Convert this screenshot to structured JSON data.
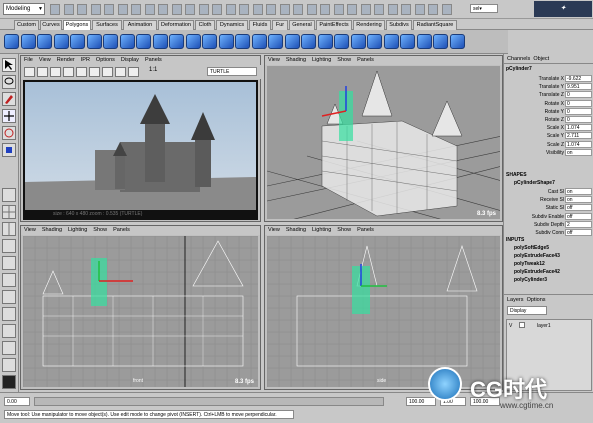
{
  "mode_menu": "Modeling",
  "shelf_tabs": [
    "Custom",
    "Curves",
    "Polygons",
    "Surfaces",
    "Animation",
    "Deformation",
    "Cloth",
    "Dynamics",
    "Fluids",
    "Fur",
    "General",
    "PaintEffects",
    "Rendering",
    "Subdivs",
    "RadiantSquare"
  ],
  "active_shelf_tab": "Polygons",
  "selection_field": "sel▾",
  "render_view": {
    "menu": [
      "File",
      "View",
      "Render",
      "IPR",
      "Options",
      "Display",
      "Panels"
    ],
    "ratio_label": "1:1",
    "renderer": "TURTLE",
    "footer": "size : 640 x 480  zoom : 0.535  (TURTLE)"
  },
  "persp": {
    "menu": [
      "View",
      "Shading",
      "Lighting",
      "Show",
      "Panels"
    ],
    "fps": "8.3 fps"
  },
  "front": {
    "menu": [
      "View",
      "Shading",
      "Lighting",
      "Show",
      "Panels"
    ],
    "fps": "8.3 fps",
    "label": "front"
  },
  "side": {
    "menu": [
      "View",
      "Shading",
      "Lighting",
      "Show",
      "Panels"
    ],
    "label": "side"
  },
  "channel_box": {
    "tabs": [
      "Channels",
      "Object"
    ],
    "node": "pCylinder7",
    "attrs": [
      {
        "k": "Translate X",
        "v": "-9.622"
      },
      {
        "k": "Translate Y",
        "v": "9.951"
      },
      {
        "k": "Translate Z",
        "v": "0"
      },
      {
        "k": "Rotate X",
        "v": "0"
      },
      {
        "k": "Rotate Y",
        "v": "0"
      },
      {
        "k": "Rotate Z",
        "v": "0"
      },
      {
        "k": "Scale X",
        "v": "1.074"
      },
      {
        "k": "Scale Y",
        "v": "2.711"
      },
      {
        "k": "Scale Z",
        "v": "1.074"
      },
      {
        "k": "Visibility",
        "v": "on"
      }
    ],
    "shapes_header": "SHAPES",
    "shape_node": "pCylinderShape7",
    "shape_attrs": [
      {
        "k": "Cast Sl",
        "v": "on"
      },
      {
        "k": "Receive Sl",
        "v": "on"
      },
      {
        "k": "Static Sl",
        "v": "off"
      },
      {
        "k": "Subdiv Enable",
        "v": "off"
      },
      {
        "k": "Subdiv Depth",
        "v": "2"
      },
      {
        "k": "Subdiv Conn",
        "v": "off"
      }
    ],
    "inputs_header": "INPUTS",
    "inputs": [
      "polySoftEdge5",
      "polyExtrudeFace43",
      "polyTweak12",
      "polyExtrudeFace42",
      "polyCylinder3"
    ]
  },
  "layers": {
    "tabs": [
      "Layers",
      "Options"
    ],
    "display": "Display",
    "layer_name": "layer1",
    "layer_v": "V"
  },
  "timeline": {
    "start": "0.00",
    "end": "100.00",
    "current": "1.00",
    "end2": "100.00"
  },
  "help_line": "Move tool: Use manipulator to move object(s). Use edit mode to change pivot (INSERT). Ctrl+LMB to move perpendicular.",
  "watermark": "CG时代",
  "watermark_url": "www.cgtime.cn",
  "colors": {
    "ui": "#c8c8c8",
    "viewport": "#9b9b9b",
    "selection": "#35e0a0",
    "manip_red": "#e02020",
    "manip_blue": "#2040e0"
  }
}
